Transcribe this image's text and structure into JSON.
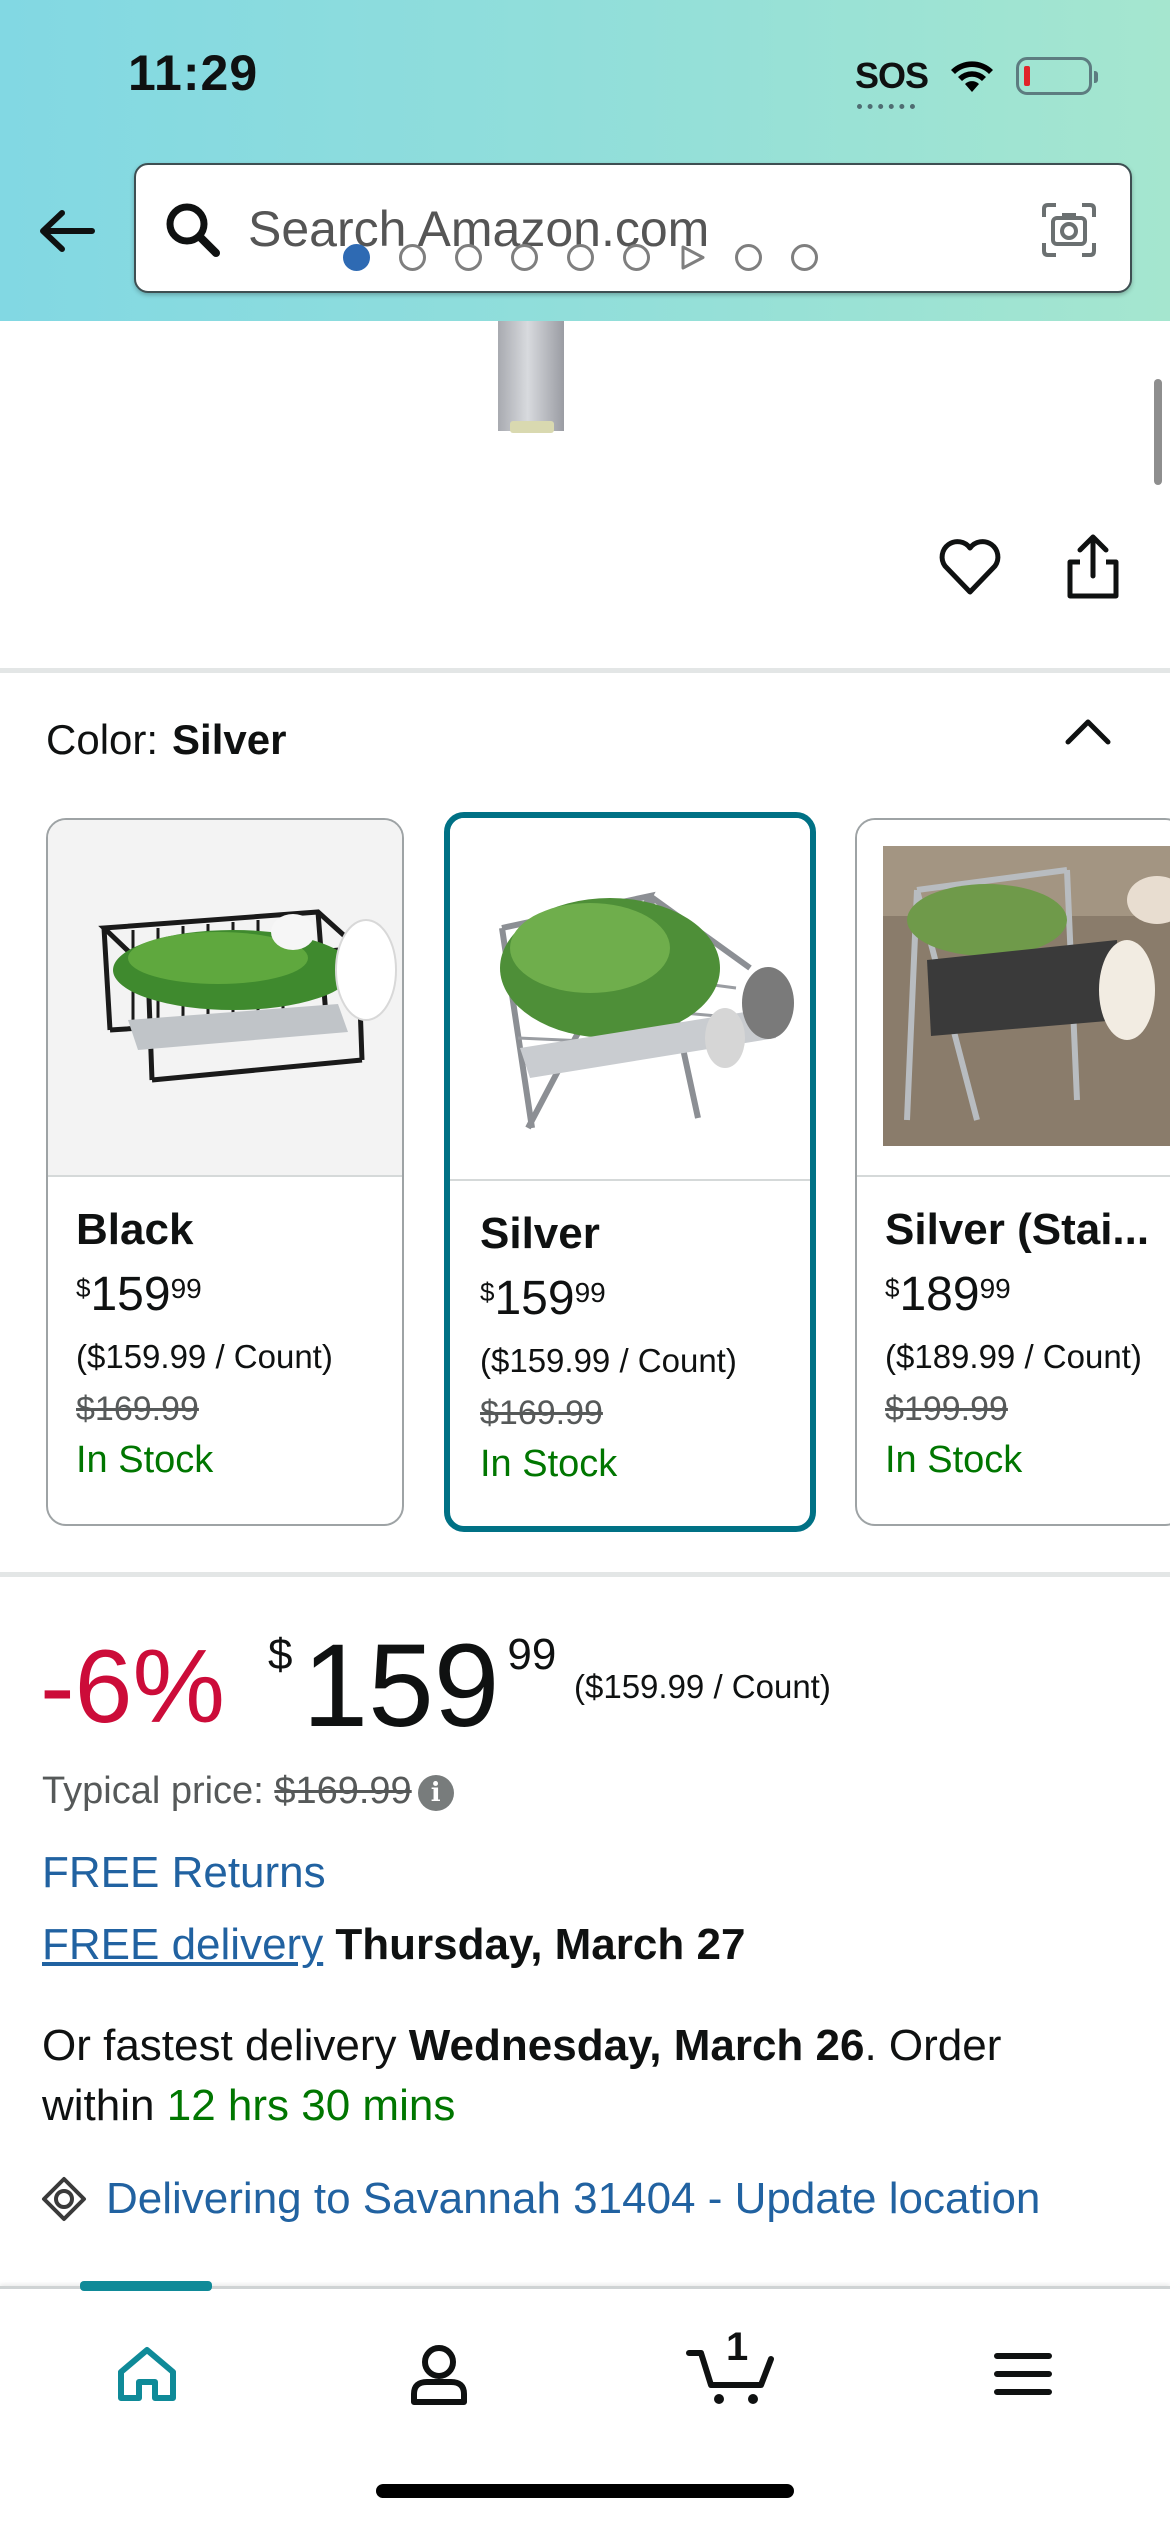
{
  "status_bar": {
    "time": "11:29",
    "sos": "SOS"
  },
  "search": {
    "placeholder": "Search Amazon.com"
  },
  "carousel": {
    "dot_count": 9,
    "active_index": 0,
    "video_index": 6
  },
  "color_selector": {
    "label": "Color:",
    "selected": "Silver",
    "options": [
      {
        "name": "Black",
        "price_whole": "159",
        "price_cents": "99",
        "currency": "$",
        "unit_price": "($159.99 / Count)",
        "was_price": "$169.99",
        "stock": "In Stock"
      },
      {
        "name": "Silver",
        "price_whole": "159",
        "price_cents": "99",
        "currency": "$",
        "unit_price": "($159.99 / Count)",
        "was_price": "$169.99",
        "stock": "In Stock"
      },
      {
        "name": "Silver (Stai...",
        "price_whole": "189",
        "price_cents": "99",
        "currency": "$",
        "unit_price": "($189.99 / Count)",
        "was_price": "$199.99",
        "stock": "In Stock"
      }
    ]
  },
  "price_block": {
    "discount": "-6%",
    "currency": "$",
    "price_whole": "159",
    "price_cents": "99",
    "unit_price": "($159.99 / Count)",
    "typical_label": "Typical price:",
    "typical_price": "$169.99",
    "free_returns": "FREE Returns",
    "free_delivery_link": "FREE delivery",
    "delivery_date": "Thursday, March 27",
    "fastest_prefix": "Or fastest delivery",
    "fastest_date": "Wednesday, March 26",
    "fastest_mid": ". Order within",
    "fastest_countdown": "12 hrs 30 mins",
    "location_text": "Delivering to Savannah 31404 - Update location"
  },
  "bottom_nav": {
    "cart_count": "1",
    "active": "home"
  },
  "colors": {
    "link": "#2162a1",
    "deal_red": "#cc0c39",
    "stock_green": "#007600",
    "selected_border": "#007185",
    "nav_accent": "#0f8a98"
  }
}
